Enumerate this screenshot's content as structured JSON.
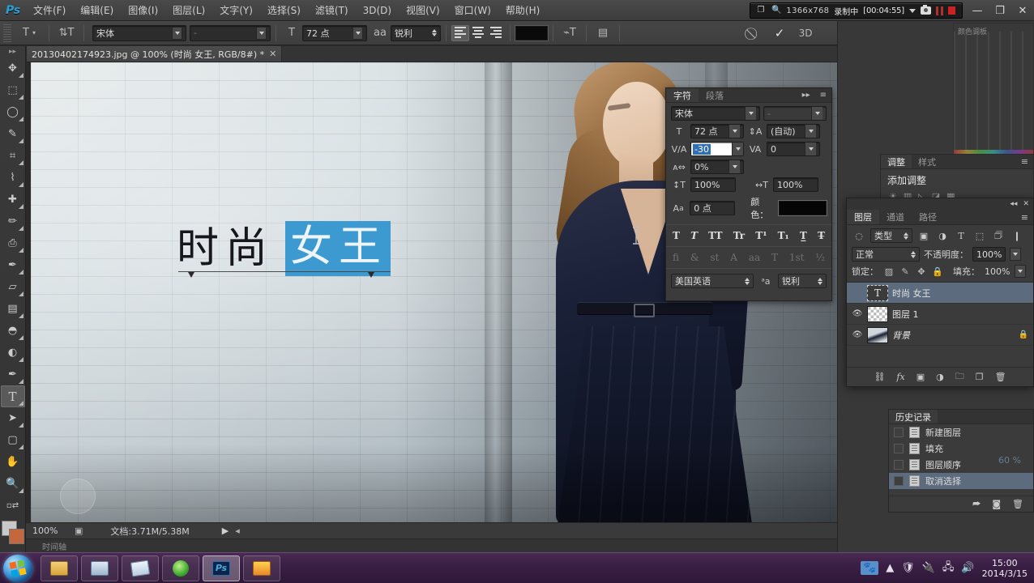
{
  "app": {
    "name": "Adobe Photoshop",
    "logo": "Ps"
  },
  "menubar": {
    "items": [
      {
        "label": "文件(F)",
        "name": "menu-file"
      },
      {
        "label": "编辑(E)",
        "name": "menu-edit"
      },
      {
        "label": "图像(I)",
        "name": "menu-image"
      },
      {
        "label": "图层(L)",
        "name": "menu-layer"
      },
      {
        "label": "文字(Y)",
        "name": "menu-type"
      },
      {
        "label": "选择(S)",
        "name": "menu-select"
      },
      {
        "label": "滤镜(T)",
        "name": "menu-filter"
      },
      {
        "label": "3D(D)",
        "name": "menu-3d"
      },
      {
        "label": "视图(V)",
        "name": "menu-view"
      },
      {
        "label": "窗口(W)",
        "name": "menu-window"
      },
      {
        "label": "帮助(H)",
        "name": "menu-help"
      }
    ]
  },
  "recorder": {
    "resolution": "1366x768",
    "status_label": "录制中",
    "timecode": "[00:04:55]",
    "icons": [
      "window-icon",
      "magnifier-icon",
      "chevron-down-icon",
      "camera-icon",
      "pause-icon",
      "stop-icon"
    ]
  },
  "window_controls": {
    "minimize": "—",
    "restore": "❐",
    "close": "✕"
  },
  "options_bar": {
    "tool_icon": "type-tool-icon",
    "orientation_icon": "text-orientation-icon",
    "font_family": "宋体",
    "font_style": "",
    "font_size": "72 点",
    "antialias_label": "aa",
    "antialias_value": "锐利",
    "align_selected": "left",
    "color_swatch": "#0a0a0a",
    "warp_icon": "warp-text-icon",
    "panels_icon": "toggle-panels-icon",
    "cancel_icon": "cancel-icon",
    "commit_icon": "commit-icon",
    "threed_label": "3D"
  },
  "toolbox": {
    "tools": [
      {
        "name": "move-tool",
        "glyph": "✥"
      },
      {
        "name": "marquee-tool",
        "glyph": "▭"
      },
      {
        "name": "lasso-tool",
        "glyph": "◯"
      },
      {
        "name": "quick-select-tool",
        "glyph": "✎"
      },
      {
        "name": "crop-tool",
        "glyph": "⌗"
      },
      {
        "name": "eyedropper-tool",
        "glyph": "⌇"
      },
      {
        "name": "healing-brush-tool",
        "glyph": "✚"
      },
      {
        "name": "brush-tool",
        "glyph": "✏"
      },
      {
        "name": "clone-stamp-tool",
        "glyph": "⎙"
      },
      {
        "name": "history-brush-tool",
        "glyph": "✒"
      },
      {
        "name": "eraser-tool",
        "glyph": "▱"
      },
      {
        "name": "gradient-tool",
        "glyph": "▤"
      },
      {
        "name": "blur-tool",
        "glyph": "💧"
      },
      {
        "name": "dodge-tool",
        "glyph": "◐"
      },
      {
        "name": "pen-tool",
        "glyph": "✒"
      },
      {
        "name": "type-tool",
        "glyph": "T",
        "selected": true
      },
      {
        "name": "path-selection-tool",
        "glyph": "➤"
      },
      {
        "name": "rectangle-tool",
        "glyph": "▢"
      },
      {
        "name": "hand-tool",
        "glyph": "✋"
      },
      {
        "name": "zoom-tool",
        "glyph": "🔍"
      }
    ],
    "foreground_color": "#c9c9c9",
    "background_color": "#c4673d"
  },
  "document": {
    "tab_title": "20130402174923.jpg @ 100% (时尚 女王, RGB/8#) *",
    "close_glyph": "✕",
    "canvas_text_plain": "时尚",
    "canvas_text_selected": "女王",
    "selection_color": "#3d9ad0"
  },
  "status_bar": {
    "zoom": "100%",
    "doc_info": "文档:3.71M/5.38M",
    "arrow": "▶",
    "timeline_label": "时间轴"
  },
  "character_panel": {
    "tabs": [
      {
        "label": "字符",
        "active": true
      },
      {
        "label": "段落",
        "active": false
      }
    ],
    "collapse_glyph": "▸▸",
    "font_family": "宋体",
    "font_style": "",
    "font_size": "72 点",
    "leading": "(自动)",
    "kerning_value": "-30",
    "kerning_is_editing": true,
    "tracking_value": "0",
    "vertical_scale_label": "0%",
    "scale_v": "100%",
    "scale_h": "100%",
    "baseline_shift": "0 点",
    "color_label": "颜色：",
    "color_value": "#050505",
    "style_buttons_row1": [
      "T",
      "T",
      "TT",
      "Tr",
      "T¹",
      "T₁",
      "T̲",
      "T̶"
    ],
    "style_buttons_row2": [
      "fi",
      "&",
      "st",
      "A",
      "aa",
      "T",
      "1st",
      "½"
    ],
    "language": "美国英语",
    "aa_icon": "aa-icon",
    "antialias": "锐利"
  },
  "color_panel": {
    "title": "颜色调板"
  },
  "adjustments_panel": {
    "tabs": [
      {
        "label": "调整",
        "active": true
      },
      {
        "label": "样式",
        "active": false
      }
    ],
    "title": "添加调整"
  },
  "layers_panel": {
    "tabs": [
      {
        "label": "图层",
        "active": true
      },
      {
        "label": "通道",
        "active": false
      },
      {
        "label": "路径",
        "active": false
      }
    ],
    "collapse_glyph": "◂◂",
    "close_glyph": "✕",
    "menu_glyph": "≡",
    "filter_kind": "类型",
    "filter_icons": [
      "pixel-filter-icon",
      "adjustment-filter-icon",
      "type-filter-icon",
      "shape-filter-icon",
      "smartobject-filter-icon"
    ],
    "blend_mode": "正常",
    "opacity_label": "不透明度：",
    "opacity_value": "100%",
    "lock_label": "锁定：",
    "lock_icons": [
      "lock-transparency-icon",
      "lock-image-icon",
      "lock-position-icon",
      "lock-all-icon"
    ],
    "fill_label": "填充：",
    "fill_value": "100%",
    "layers": [
      {
        "name": "时尚 女王",
        "type": "text",
        "visible": true,
        "selected": true,
        "locked": false
      },
      {
        "name": "图层 1",
        "type": "pixel",
        "visible": true,
        "selected": false,
        "locked": false
      },
      {
        "name": "背景",
        "type": "background",
        "visible": true,
        "selected": false,
        "locked": true
      }
    ],
    "footer_icons": [
      "link-layers-icon",
      "layer-style-icon",
      "layer-mask-icon",
      "adjustment-layer-icon",
      "new-group-icon",
      "new-layer-icon",
      "delete-layer-icon"
    ],
    "footer_labels": [
      "⛓",
      "fx",
      "▣",
      "◑",
      "🗀",
      "❐",
      "🗑"
    ]
  },
  "history_panel": {
    "tabs": [
      {
        "label": "历史记录",
        "active": true
      }
    ],
    "items": [
      {
        "label": "新建图层",
        "selected": false
      },
      {
        "label": "填充",
        "selected": false
      },
      {
        "label": "图层顺序",
        "selected": false
      },
      {
        "label": "取消选择",
        "selected": true
      }
    ],
    "footer_icons": [
      "new-document-from-state-icon",
      "new-snapshot-icon",
      "delete-state-icon"
    ],
    "footer_labels": [
      "⮫",
      "◙",
      "🗑"
    ],
    "badge": "60 %"
  },
  "taskbar": {
    "start_name": "start-orb",
    "items": [
      {
        "name": "taskbar-explorer",
        "active": false
      },
      {
        "name": "taskbar-calculator",
        "active": false
      },
      {
        "name": "taskbar-notepad",
        "active": false
      },
      {
        "name": "taskbar-browser",
        "active": false
      },
      {
        "name": "taskbar-photoshop",
        "active": true
      },
      {
        "name": "taskbar-kuaibo",
        "active": false
      }
    ],
    "tray_icons": [
      "paw-icon",
      "show-hidden-icon",
      "shield-icon",
      "usb-icon",
      "network-icon",
      "volume-icon"
    ],
    "tray_glyphs": [
      "▲",
      "🛡",
      "🔌",
      "🖧",
      "🔊"
    ],
    "clock_time": "15:00",
    "clock_date": "2014/3/15"
  }
}
